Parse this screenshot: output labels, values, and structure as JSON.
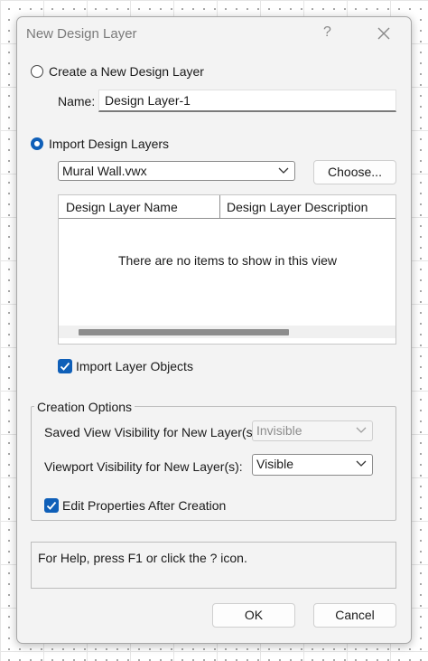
{
  "dialog": {
    "title": "New Design Layer",
    "help_glyph": "?",
    "close_icon": "close-icon"
  },
  "create_new": {
    "label": "Create a New Design Layer",
    "selected": false,
    "name_label": "Name:",
    "name_value": "Design Layer-1"
  },
  "import": {
    "label": "Import Design Layers",
    "selected": true,
    "file_value": "Mural Wall.vwx",
    "choose_label": "Choose..."
  },
  "layer_list": {
    "columns": [
      "Design Layer Name",
      "Design Layer Description"
    ],
    "empty_text": "There are no items to show in this view"
  },
  "import_objects": {
    "label": "Import Layer Objects",
    "checked": true
  },
  "creation_options": {
    "legend": "Creation Options",
    "saved_view_label": "Saved View Visibility for New Layer(s):",
    "saved_view_value": "Invisible",
    "viewport_label": "Viewport Visibility for New Layer(s):",
    "viewport_value": "Visible",
    "edit_props_label": "Edit Properties After Creation",
    "edit_props_checked": true
  },
  "status": {
    "text": "For Help, press F1 or click the ? icon."
  },
  "buttons": {
    "ok": "OK",
    "cancel": "Cancel"
  },
  "colors": {
    "accent": "#0f5fb8",
    "dialog_bg": "#f3f3f3"
  }
}
